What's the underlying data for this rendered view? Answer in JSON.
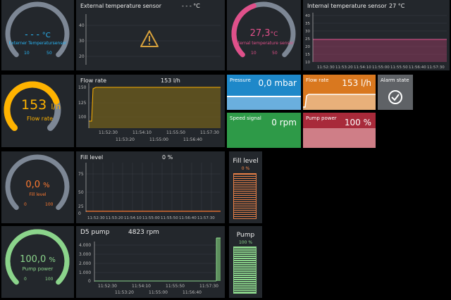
{
  "gauges": {
    "ext_temp": {
      "value": "- - -",
      "unit": "°C",
      "caption": "Externer Temperatursensor",
      "min": "10",
      "max": "50",
      "color": "#29b6f6",
      "track": "#7d8795",
      "fraction": 0
    },
    "int_temp": {
      "value": "27,3",
      "unit": "°C",
      "caption": "Internal temperature sensor",
      "min": "10",
      "max": "50",
      "color": "#e0508a",
      "track": "#7d8795",
      "fraction": 0.43
    },
    "flow": {
      "value": "153",
      "unit": "l/h",
      "caption": "Flow rate",
      "color": "#ffb300",
      "track": "#7d8795",
      "fraction": 0.76
    },
    "fill": {
      "value": "0,0",
      "unit": "%",
      "caption": "Fill level",
      "min": "0",
      "max": "100",
      "color": "#ff7a30",
      "track": "#7d8795",
      "fraction": 0
    },
    "pump": {
      "value": "100,0",
      "unit": "%",
      "caption": "Pump power",
      "min": "0",
      "max": "100",
      "color": "#8bd48b",
      "track": "#8bd48b",
      "fraction": 1
    }
  },
  "charts": {
    "ext_temp": {
      "title": "External temperature sensor",
      "value": "- - -  °C",
      "yticks": [
        "40",
        "30",
        "20",
        "10"
      ]
    },
    "int_temp": {
      "title": "Internal temperature sensor",
      "value": "27 °C",
      "yticks": [
        "40",
        "35",
        "30",
        "25",
        "20",
        "15",
        "10"
      ],
      "xticks_top": [
        "11:52:30",
        "11:53:20",
        "11:54:10",
        "11:55:00",
        "11:55:50",
        "11:56:40",
        "11:57:30"
      ]
    },
    "flow": {
      "title": "Flow rate",
      "value": "153 l/h",
      "yticks": [
        "150",
        "125",
        "100"
      ],
      "xticks_top": [
        "11:52:30",
        "11:54:10",
        "11:55:50",
        "11:57:30"
      ],
      "xticks_bot": [
        "11:53:20",
        "11:55:00",
        "11:56:40"
      ]
    },
    "fill": {
      "title": "Fill level",
      "value": "0 %",
      "yticks": [
        "75",
        "50",
        "25",
        "0"
      ],
      "xticks_top": [
        "11:52:30",
        "11:53:20",
        "11:54:10",
        "11:55:00",
        "11:55:50",
        "11:56:40",
        "11:57:30"
      ]
    },
    "d5": {
      "title": "D5 pump",
      "value": "4823 rpm",
      "yticks": [
        "4.000",
        "3.000",
        "2.000",
        "1.000",
        "0"
      ],
      "xticks_top": [
        "11:52:30",
        "11:54:10",
        "11:55:50",
        "11:57:30"
      ],
      "xticks_bot": [
        "11:53:20",
        "11:55:00",
        "11:56:40"
      ]
    }
  },
  "stats": {
    "pressure": {
      "label": "Pressure",
      "value": "0,0 mbar",
      "color": "#1e88c9"
    },
    "flow": {
      "label": "Flow rate",
      "value": "153 l/h",
      "color": "#d9781f"
    },
    "speed": {
      "label": "Speed signal",
      "value": "0 rpm",
      "color": "#2e9a48"
    },
    "pump": {
      "label": "Pump power",
      "value": "100 %",
      "color": "#a82a3a"
    },
    "alarm": {
      "label": "Alarm state"
    }
  },
  "bars": {
    "fill": {
      "label": "Fill level",
      "value": "0 %",
      "color": "#ff8a4a",
      "fraction": 0
    },
    "pump": {
      "label": "Pump",
      "value": "100 %",
      "color": "#8bd48b",
      "fraction": 1
    }
  }
}
